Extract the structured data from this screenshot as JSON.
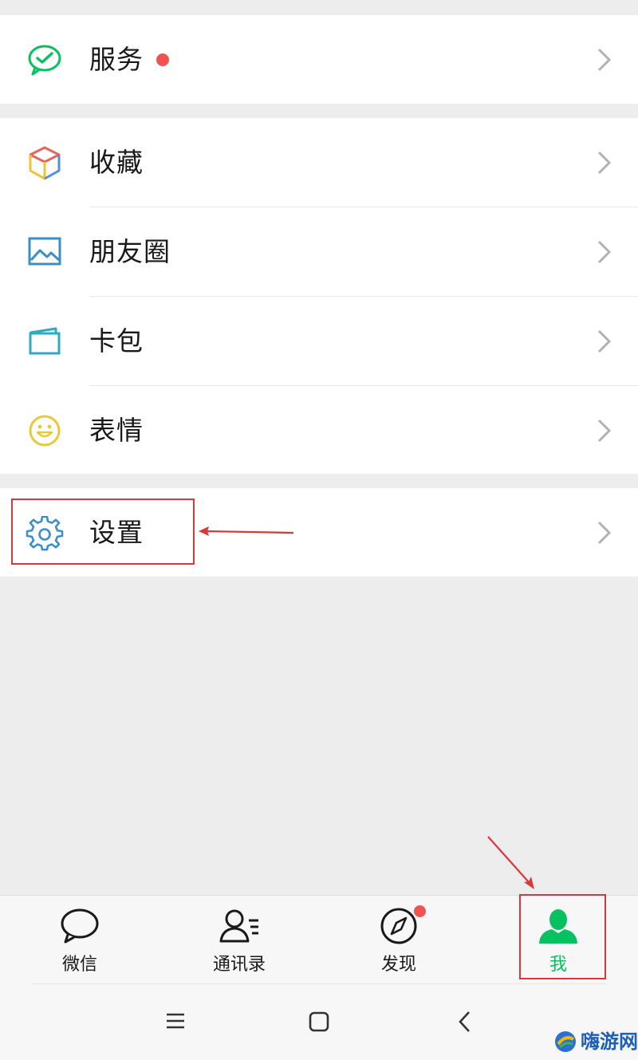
{
  "colors": {
    "background": "#ededed",
    "accent_green": "#07c160",
    "badge_red": "#f05451",
    "annotation_red": "#d9383a"
  },
  "menu": {
    "services": {
      "label": "服务",
      "icon": "wechat-pay-check-icon"
    },
    "favorites": {
      "label": "收藏",
      "icon": "cube-icon"
    },
    "moments": {
      "label": "朋友圈",
      "icon": "picture-icon"
    },
    "card_pack": {
      "label": "卡包",
      "icon": "wallet-icon"
    },
    "stickers": {
      "label": "表情",
      "icon": "smiley-icon"
    },
    "settings": {
      "label": "设置",
      "icon": "gear-icon"
    }
  },
  "tabbar": {
    "tabs": [
      {
        "label": "微信",
        "icon": "chat-bubble-icon",
        "active": false
      },
      {
        "label": "通讯录",
        "icon": "contacts-icon",
        "active": false
      },
      {
        "label": "发现",
        "icon": "compass-icon",
        "active": false,
        "badge": true
      },
      {
        "label": "我",
        "icon": "person-icon",
        "active": true
      }
    ]
  },
  "system_nav": {
    "icons": [
      "menu-icon",
      "home-icon",
      "back-icon"
    ]
  },
  "watermark": {
    "text": "嗨游网"
  }
}
